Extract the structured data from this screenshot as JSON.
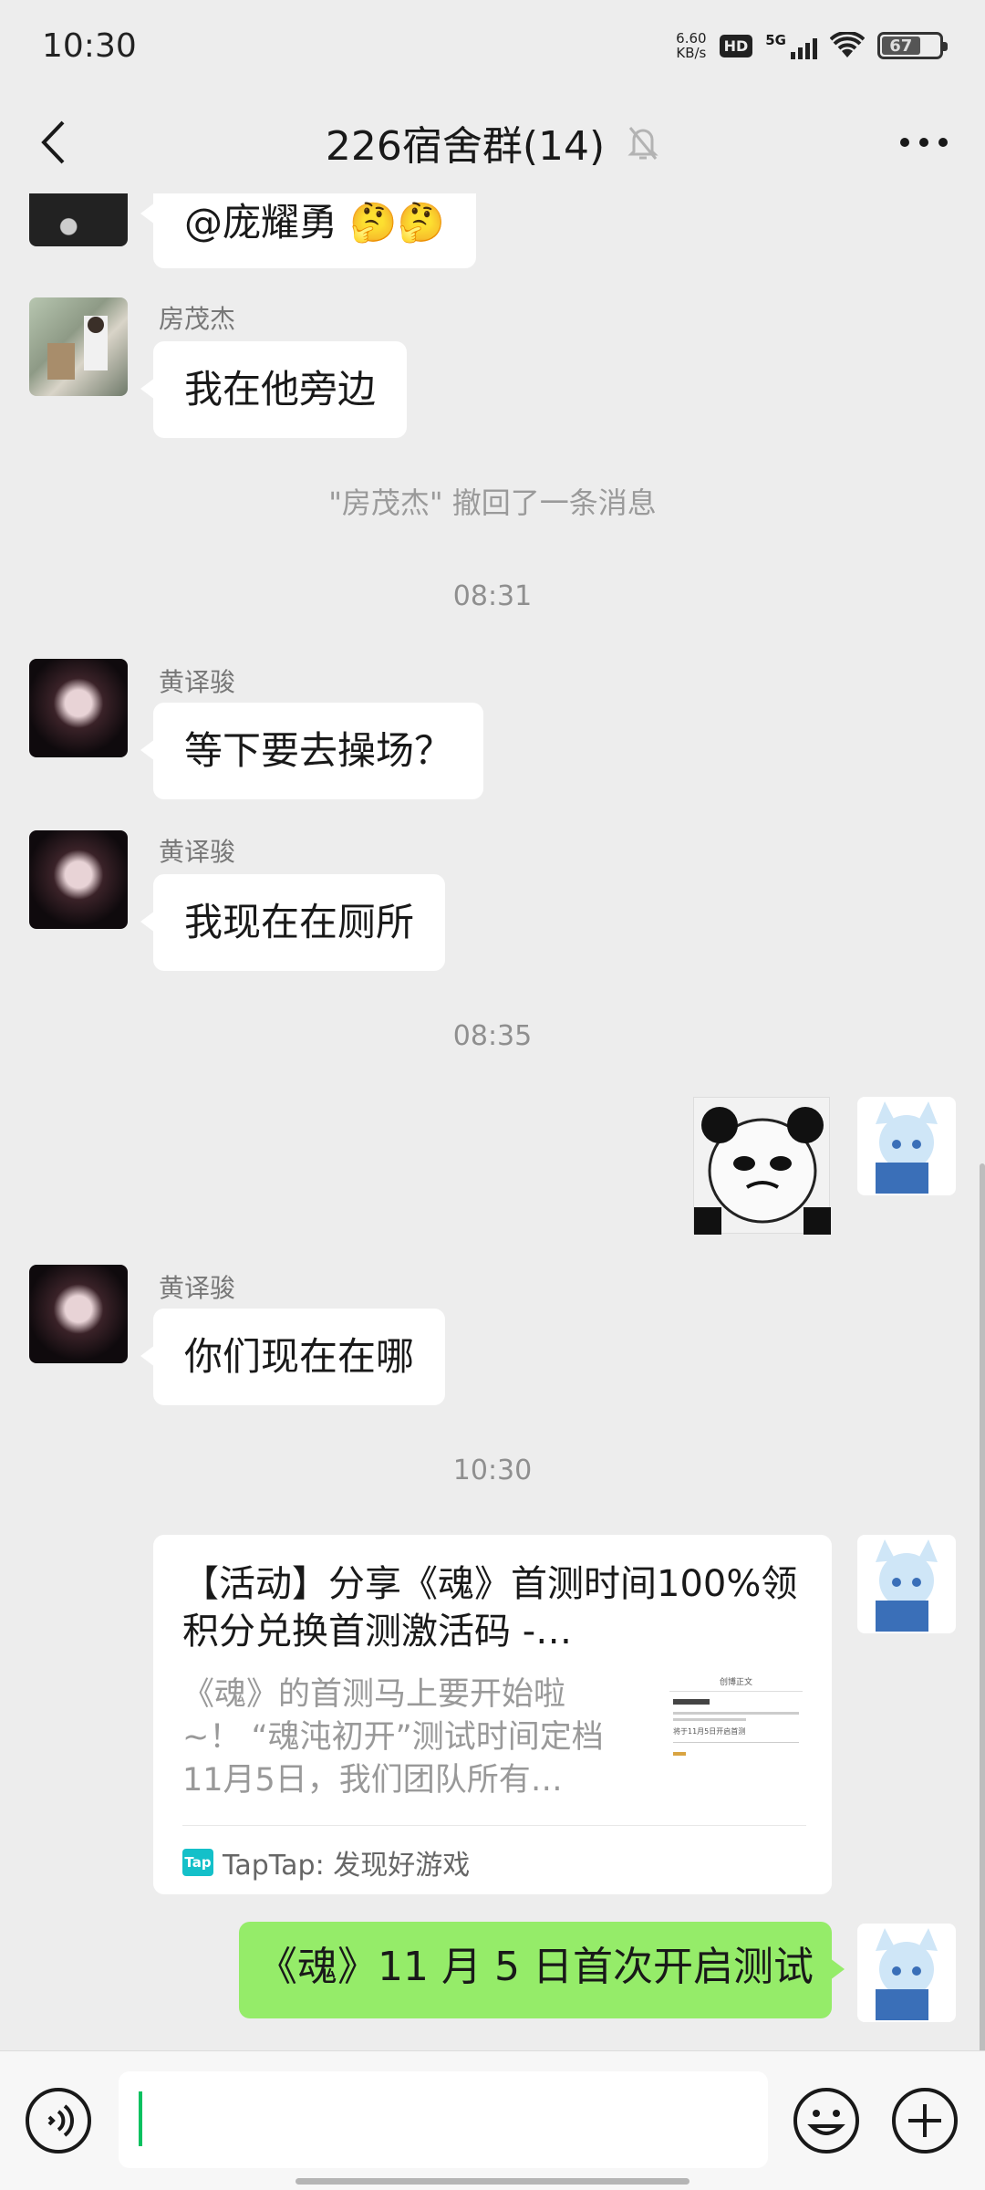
{
  "status_bar": {
    "time": "10:30",
    "net_speed_value": "6.60",
    "net_speed_unit": "KB/s",
    "hd": "HD",
    "network": "5G",
    "battery": "67"
  },
  "header": {
    "title": "226宿舍群(14)"
  },
  "messages": {
    "m1": {
      "text": "@庞耀勇 🤔🤔"
    },
    "m2": {
      "sender": "房茂杰",
      "text": "我在他旁边"
    },
    "recall_notice": "\"房茂杰\" 撤回了一条消息",
    "time1": "08:31",
    "m3": {
      "sender": "黄译骏",
      "text": "等下要去操场？"
    },
    "m4": {
      "sender": "黄译骏",
      "text": "我现在在厕所"
    },
    "time2": "08:35",
    "m6": {
      "sender": "黄译骏",
      "text": "你们现在在哪"
    },
    "time3": "10:30",
    "card": {
      "title": "【活动】分享《魂》首测时间100%领积分兑换首测激活码 -…",
      "description": "《魂》的首测马上要开始啦~！ “魂沌初开”测试时间定档11月5日，我们团队所有…",
      "thumb_heading": "创博正文",
      "thumb_line": "将于11月5日开启首测",
      "source_logo": "Tap",
      "source": "TapTap: 发现好游戏"
    },
    "m8": {
      "text": "《魂》11 月 5 日首次开启测试"
    }
  },
  "colors": {
    "background": "#ededed",
    "bubble_incoming": "#ffffff",
    "bubble_outgoing": "#95ec69",
    "accent_caret": "#07c160",
    "taptap": "#14c0c9"
  },
  "icons": {
    "back": "chevron-left-icon",
    "mute": "bell-muted-icon",
    "more": "more-dots-icon",
    "voice": "voice-icon",
    "emoji": "emoji-icon",
    "plus": "plus-icon"
  }
}
